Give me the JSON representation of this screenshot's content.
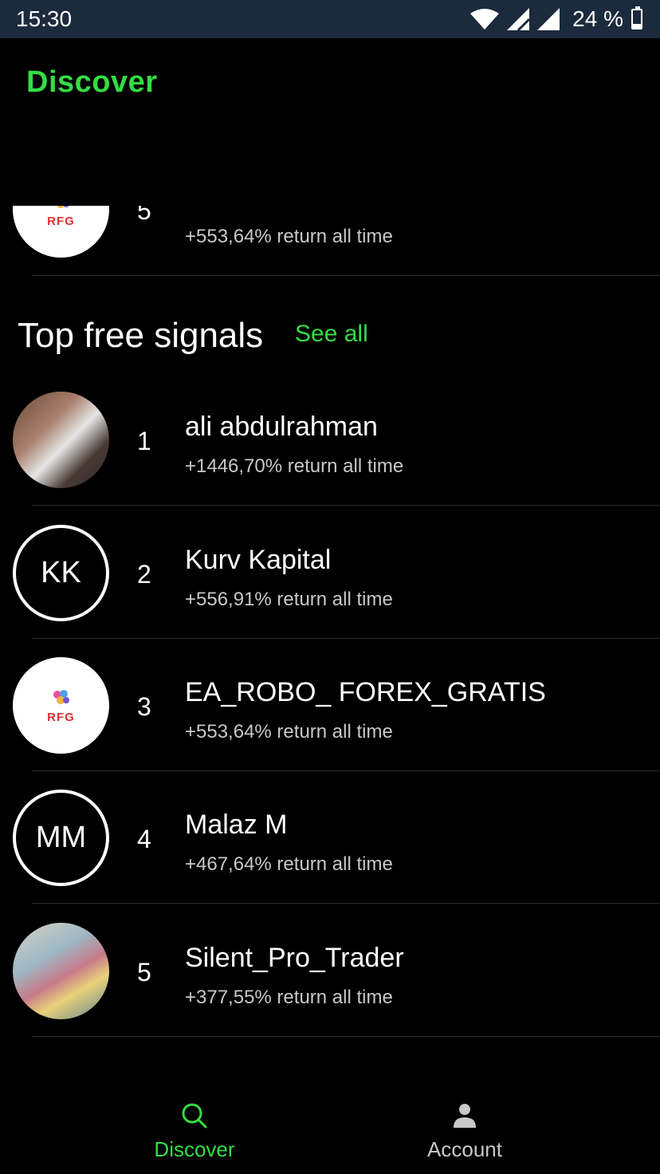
{
  "status_bar": {
    "time": "15:30",
    "battery": "24 %"
  },
  "header": {
    "title": "Discover"
  },
  "partial_top_item": {
    "rank": "5",
    "return_text": "+553,64% return all time",
    "avatar_text": "RFG"
  },
  "section": {
    "title": "Top free signals",
    "see_all": "See all"
  },
  "signals": [
    {
      "rank": "1",
      "name": "ali abdulrahman",
      "return_text": "+1446,70% return all time",
      "avatar_type": "photo"
    },
    {
      "rank": "2",
      "name": "Kurv Kapital",
      "return_text": "+556,91% return all time",
      "avatar_initials": "KK"
    },
    {
      "rank": "3",
      "name": "EA_ROBO_ FOREX_GRATIS",
      "return_text": "+553,64% return all time",
      "avatar_text": "RFG"
    },
    {
      "rank": "4",
      "name": "Malaz M",
      "return_text": "+467,64% return all time",
      "avatar_initials": "MM"
    },
    {
      "rank": "5",
      "name": "Silent_Pro_Trader",
      "return_text": "+377,55% return all time",
      "avatar_type": "photo"
    }
  ],
  "bottom_nav": {
    "discover": "Discover",
    "account": "Account"
  },
  "colors": {
    "accent": "#33dd44",
    "statusbar": "#1c2a3d",
    "background": "#000000"
  }
}
